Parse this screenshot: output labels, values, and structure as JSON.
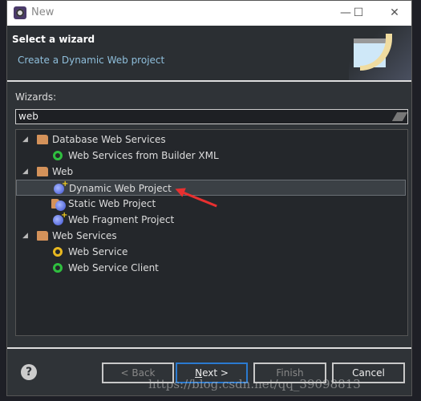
{
  "window": {
    "title": "New",
    "icon": "eclipse-icon"
  },
  "header": {
    "title": "Select a wizard",
    "description": "Create a Dynamic Web project"
  },
  "wizards_label": "Wizards:",
  "search": {
    "value": "web"
  },
  "tree": [
    {
      "label": "Database Web Services",
      "type": "folder",
      "expanded": true,
      "level": 0
    },
    {
      "label": "Web Services from Builder XML",
      "type": "webservice-green",
      "level": 1
    },
    {
      "label": "Web",
      "type": "folder",
      "expanded": true,
      "level": 0
    },
    {
      "label": "Dynamic Web Project",
      "type": "globe-plus",
      "level": 1,
      "selected": true
    },
    {
      "label": "Static Web Project",
      "type": "folder-globe",
      "level": 1
    },
    {
      "label": "Web Fragment Project",
      "type": "globe-plus",
      "level": 1
    },
    {
      "label": "Web Services",
      "type": "folder",
      "expanded": true,
      "level": 0
    },
    {
      "label": "Web Service",
      "type": "webservice-yellow",
      "level": 1
    },
    {
      "label": "Web Service Client",
      "type": "webservice-green",
      "level": 1
    }
  ],
  "buttons": {
    "back": "< Back",
    "next_n": "N",
    "next_rest": "ext >",
    "finish": "Finish",
    "cancel": "Cancel"
  },
  "watermark": "https://blog.csdn.net/qq_39098813",
  "colors": {
    "accent": "#2a7ad0",
    "annotation_arrow": "#e83030"
  }
}
